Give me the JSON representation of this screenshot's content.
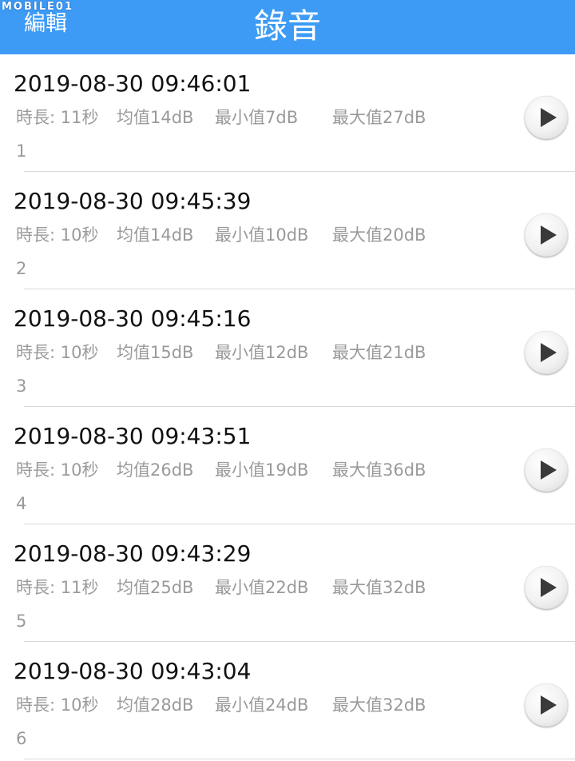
{
  "header": {
    "watermark": "MOBILE01",
    "edit_label": "編輯",
    "title": "錄音"
  },
  "recordings": [
    {
      "timestamp": "2019-08-30 09:46:01",
      "duration": "時長: 11秒",
      "avg": "均值14dB",
      "min": "最小值7dB",
      "max": "最大值27dB",
      "index": "1"
    },
    {
      "timestamp": "2019-08-30 09:45:39",
      "duration": "時長: 10秒",
      "avg": "均值14dB",
      "min": "最小值10dB",
      "max": "最大值20dB",
      "index": "2"
    },
    {
      "timestamp": "2019-08-30 09:45:16",
      "duration": "時長: 10秒",
      "avg": "均值15dB",
      "min": "最小值12dB",
      "max": "最大值21dB",
      "index": "3"
    },
    {
      "timestamp": "2019-08-30 09:43:51",
      "duration": "時長: 10秒",
      "avg": "均值26dB",
      "min": "最小值19dB",
      "max": "最大值36dB",
      "index": "4"
    },
    {
      "timestamp": "2019-08-30 09:43:29",
      "duration": "時長: 11秒",
      "avg": "均值25dB",
      "min": "最小值22dB",
      "max": "最大值32dB",
      "index": "5"
    },
    {
      "timestamp": "2019-08-30 09:43:04",
      "duration": "時長: 10秒",
      "avg": "均值28dB",
      "min": "最小值24dB",
      "max": "最大值32dB",
      "index": "6"
    }
  ],
  "icons": {
    "play": "play-icon"
  },
  "colors": {
    "header_bg": "#3d9bf5",
    "text_primary": "#111111",
    "text_secondary": "#9a9a9a"
  }
}
